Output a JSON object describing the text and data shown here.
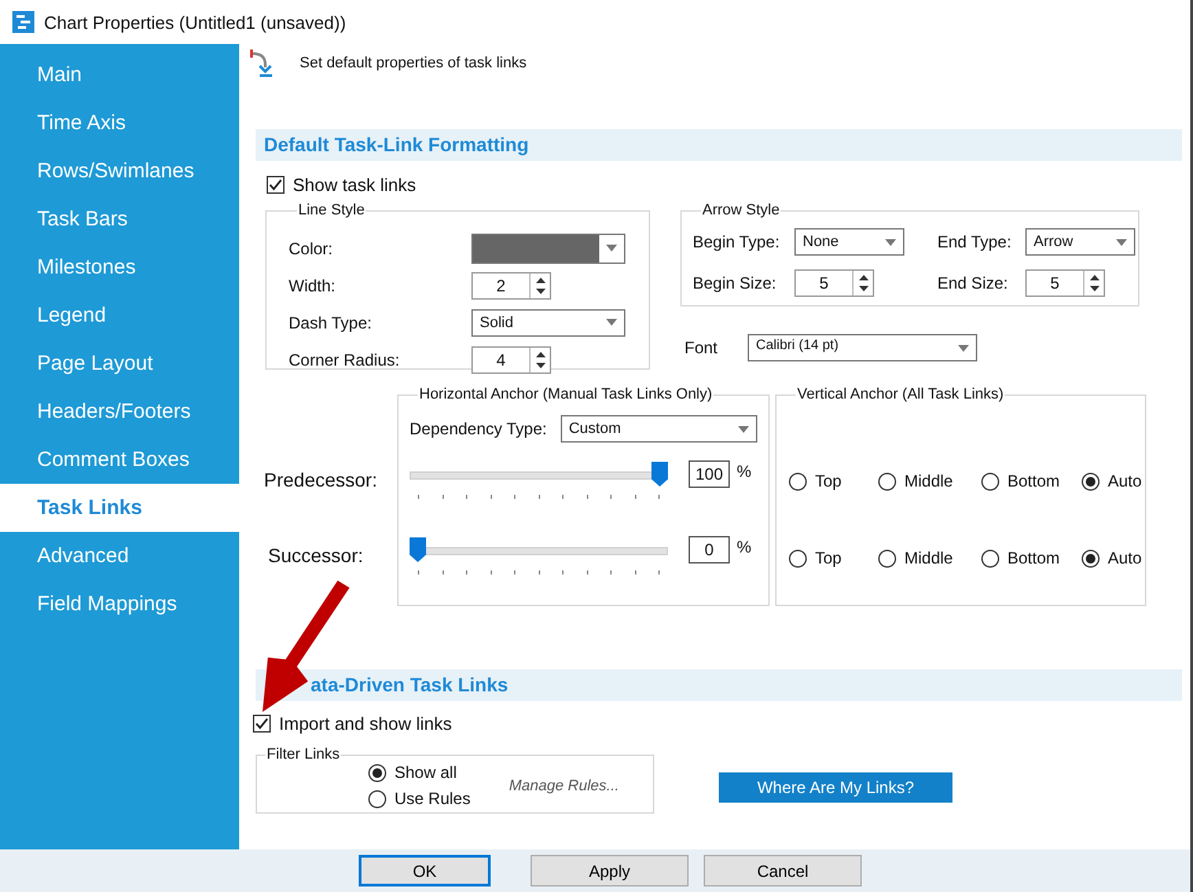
{
  "window": {
    "title": "Chart Properties (Untitled1 (unsaved))"
  },
  "sidebar": {
    "items": [
      {
        "label": "Main",
        "selected": false
      },
      {
        "label": "Time Axis",
        "selected": false
      },
      {
        "label": "Rows/Swimlanes",
        "selected": false
      },
      {
        "label": "Task Bars",
        "selected": false
      },
      {
        "label": "Milestones",
        "selected": false
      },
      {
        "label": "Legend",
        "selected": false
      },
      {
        "label": "Page Layout",
        "selected": false
      },
      {
        "label": "Headers/Footers",
        "selected": false
      },
      {
        "label": "Comment Boxes",
        "selected": false
      },
      {
        "label": "Task Links",
        "selected": true
      },
      {
        "label": "Advanced",
        "selected": false
      },
      {
        "label": "Field Mappings",
        "selected": false
      }
    ]
  },
  "header": {
    "text": "Set default properties of task links"
  },
  "default_formatting": {
    "heading": "Default Task-Link Formatting",
    "show_links": {
      "label": "Show task links",
      "checked": true
    },
    "line_style": {
      "title": "Line Style",
      "color": {
        "label": "Color:",
        "color": "#666666"
      },
      "width": {
        "label": "Width:",
        "value": "2"
      },
      "dash_type": {
        "label": "Dash Type:",
        "value": "Solid"
      },
      "corner_radius": {
        "label": "Corner Radius:",
        "value": "4"
      }
    },
    "arrow_style": {
      "title": "Arrow Style",
      "begin_type": {
        "label": "Begin Type:",
        "value": "None"
      },
      "end_type": {
        "label": "End Type:",
        "value": "Arrow"
      },
      "begin_size": {
        "label": "Begin Size:",
        "value": "5"
      },
      "end_size": {
        "label": "End Size:",
        "value": "5"
      }
    },
    "font": {
      "label": "Font",
      "value": "Calibri (14 pt)"
    },
    "horizontal_anchor": {
      "title": "Horizontal Anchor (Manual Task Links Only)",
      "dependency_type": {
        "label": "Dependency Type:",
        "value": "Custom"
      },
      "sliders": [
        {
          "label": "Predecessor:",
          "level": 1,
          "value": "100",
          "unit": "%"
        },
        {
          "label": "Successor:",
          "level": 0,
          "value": "0",
          "unit": "%"
        }
      ]
    },
    "vertical_anchor": {
      "title": "Vertical Anchor (All Task Links)",
      "rows": [
        {
          "options": [
            {
              "label": "Top",
              "selected": false
            },
            {
              "label": "Middle",
              "selected": false
            },
            {
              "label": "Bottom",
              "selected": false
            },
            {
              "label": "Auto",
              "selected": true
            }
          ]
        },
        {
          "options": [
            {
              "label": "Top",
              "selected": false
            },
            {
              "label": "Middle",
              "selected": false
            },
            {
              "label": "Bottom",
              "selected": false
            },
            {
              "label": "Auto",
              "selected": true
            }
          ]
        }
      ]
    }
  },
  "data_driven": {
    "heading": "ata-Driven Task Links",
    "import_links": {
      "label": "Import and show links",
      "checked": true
    },
    "filter": {
      "title": "Filter Links",
      "options": [
        {
          "label": "Show all",
          "selected": true
        },
        {
          "label": "Use Rules",
          "selected": false
        }
      ],
      "link": "Manage Rules..."
    },
    "button": "Where Are My Links?"
  },
  "buttons": [
    {
      "label": "OK",
      "default": true
    },
    {
      "label": "Apply",
      "default": false
    },
    {
      "label": "Cancel",
      "default": false
    }
  ]
}
